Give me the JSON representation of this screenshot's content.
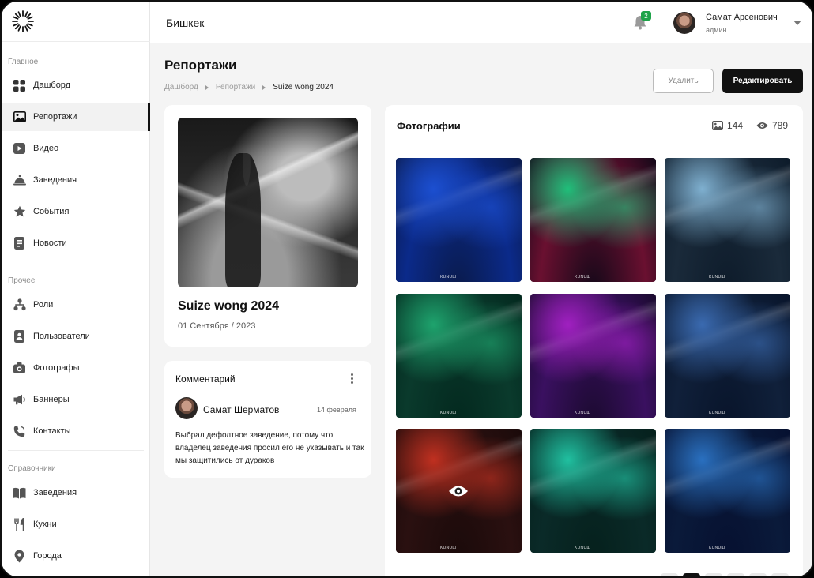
{
  "sidebar": {
    "sections": [
      {
        "label": "Главное",
        "items": [
          {
            "label": "Дашборд",
            "icon": "grid-icon"
          },
          {
            "label": "Репортажи",
            "icon": "image-icon",
            "active": true
          },
          {
            "label": "Видео",
            "icon": "play-icon"
          },
          {
            "label": "Заведения",
            "icon": "cloche-icon"
          },
          {
            "label": "События",
            "icon": "star-icon"
          },
          {
            "label": "Новости",
            "icon": "newspaper-icon"
          }
        ]
      },
      {
        "label": "Прочее",
        "items": [
          {
            "label": "Роли",
            "icon": "hierarchy-icon"
          },
          {
            "label": "Пользователи",
            "icon": "id-card-icon"
          },
          {
            "label": "Фотографы",
            "icon": "camera-icon"
          },
          {
            "label": "Баннеры",
            "icon": "megaphone-icon"
          },
          {
            "label": "Контакты",
            "icon": "phone-icon"
          }
        ]
      },
      {
        "label": "Справочники",
        "items": [
          {
            "label": "Заведения",
            "icon": "book-icon"
          },
          {
            "label": "Кухни",
            "icon": "fork-icon"
          },
          {
            "label": "Города",
            "icon": "pin-icon"
          }
        ]
      }
    ]
  },
  "header": {
    "city": "Бишкек",
    "notifications": "2",
    "user_name": "Самат Арсенович",
    "user_role": "админ"
  },
  "page": {
    "title": "Репортажи",
    "breadcrumbs": [
      "Дашборд",
      "Репортажи",
      "Suize wong 2024"
    ],
    "delete_label": "Удалить",
    "edit_label": "Редактировать"
  },
  "report": {
    "title": "Suize wong 2024",
    "date": "01 Сентября / 2023"
  },
  "comment": {
    "heading": "Комментарий",
    "author": "Самат Шерматов",
    "date": "14 февраля",
    "text": "Выбрал дефолтное заведение, потому что владелец заведения просил его не указывать и так мы защитились от дураков"
  },
  "photos": {
    "heading": "Фотографии",
    "photo_count": "144",
    "view_count": "789",
    "watermark": "KUNUШ",
    "items": [
      {
        "name": "photo-1",
        "palette": [
          "#0a1a4a",
          "#1c4fd0",
          "#0b2a8a"
        ]
      },
      {
        "name": "photo-2",
        "palette": [
          "#120818",
          "#1fbf7a",
          "#6a1030"
        ]
      },
      {
        "name": "photo-3",
        "palette": [
          "#0d1b2a",
          "#7fb0d0",
          "#1a2a3a"
        ]
      },
      {
        "name": "photo-4",
        "palette": [
          "#03281e",
          "#1ea36d",
          "#0a3a2c"
        ]
      },
      {
        "name": "photo-5",
        "palette": [
          "#1a0a2e",
          "#a020c0",
          "#3a1060"
        ]
      },
      {
        "name": "photo-6",
        "palette": [
          "#08142a",
          "#3a6ab0",
          "#10203a"
        ]
      },
      {
        "name": "photo-7",
        "palette": [
          "#1a0a0a",
          "#c03020",
          "#2a1010"
        ],
        "hover": true
      },
      {
        "name": "photo-8",
        "palette": [
          "#05201c",
          "#20c0a0",
          "#0a2a28"
        ]
      },
      {
        "name": "photo-9",
        "palette": [
          "#061030",
          "#2a70c0",
          "#0a1a3a"
        ]
      }
    ]
  }
}
